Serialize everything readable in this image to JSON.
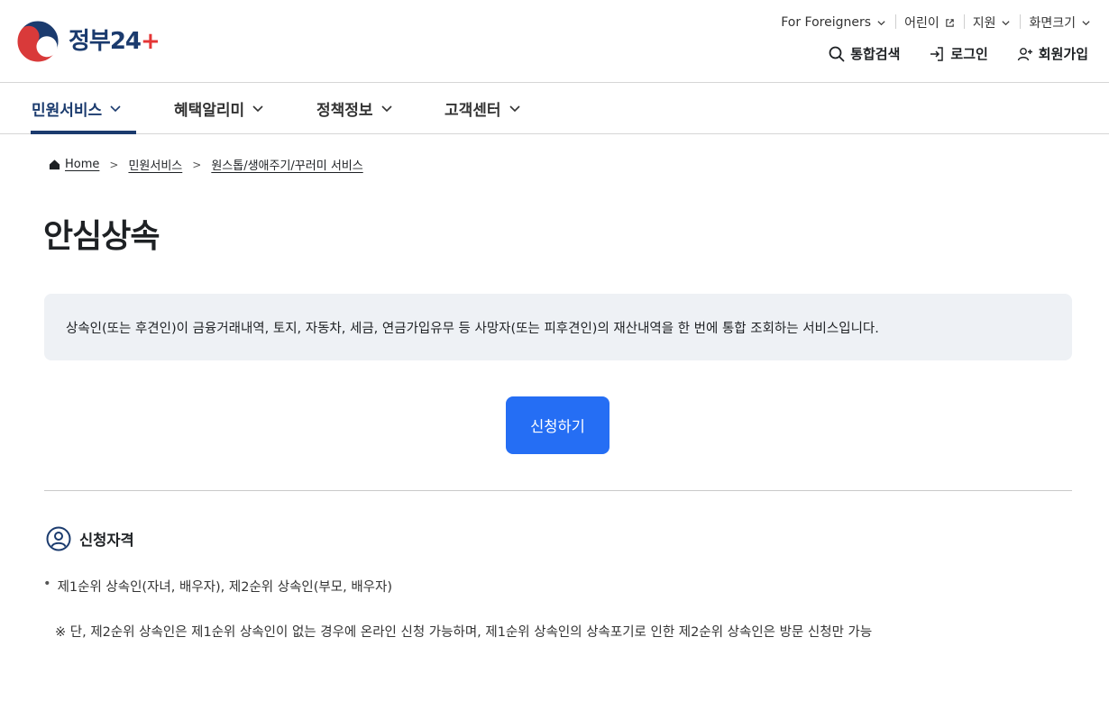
{
  "logo": {
    "text": "정부",
    "number": "24"
  },
  "utility": {
    "foreigners": "For Foreigners",
    "children": "어린이",
    "support": "지원",
    "font_size": "화면크기"
  },
  "actions": {
    "search": "통합검색",
    "login": "로그인",
    "signup": "회원가입"
  },
  "nav": {
    "items": [
      {
        "label": "민원서비스"
      },
      {
        "label": "혜택알리미"
      },
      {
        "label": "정책정보"
      },
      {
        "label": "고객센터"
      }
    ]
  },
  "breadcrumb": {
    "home": "Home",
    "level1": "민원서비스",
    "level2": "원스톱/생애주기/꾸러미 서비스"
  },
  "page": {
    "title": "안심상속",
    "description": "상속인(또는 후견인)이 금융거래내역, 토지, 자동차, 세금, 연금가입유무 등 사망자(또는 피후견인)의 재산내역을 한 번에 통합 조회하는 서비스입니다.",
    "apply_button": "신청하기"
  },
  "eligibility": {
    "heading": "신청자격",
    "bullet": "제1순위 상속인(자녀, 배우자), 제2순위 상속인(부모, 배우자)",
    "note": "※ 단, 제2순위 상속인은 제1순위 상속인이 없는 경우에 온라인 신청 가능하며, 제1순위 상속인의 상속포기로 인한 제2순위 상속인은 방문 신청만 가능"
  },
  "colors": {
    "brand_navy": "#1b3b6e",
    "primary_button": "#256ef4",
    "notice_bg": "#eef1f5"
  }
}
